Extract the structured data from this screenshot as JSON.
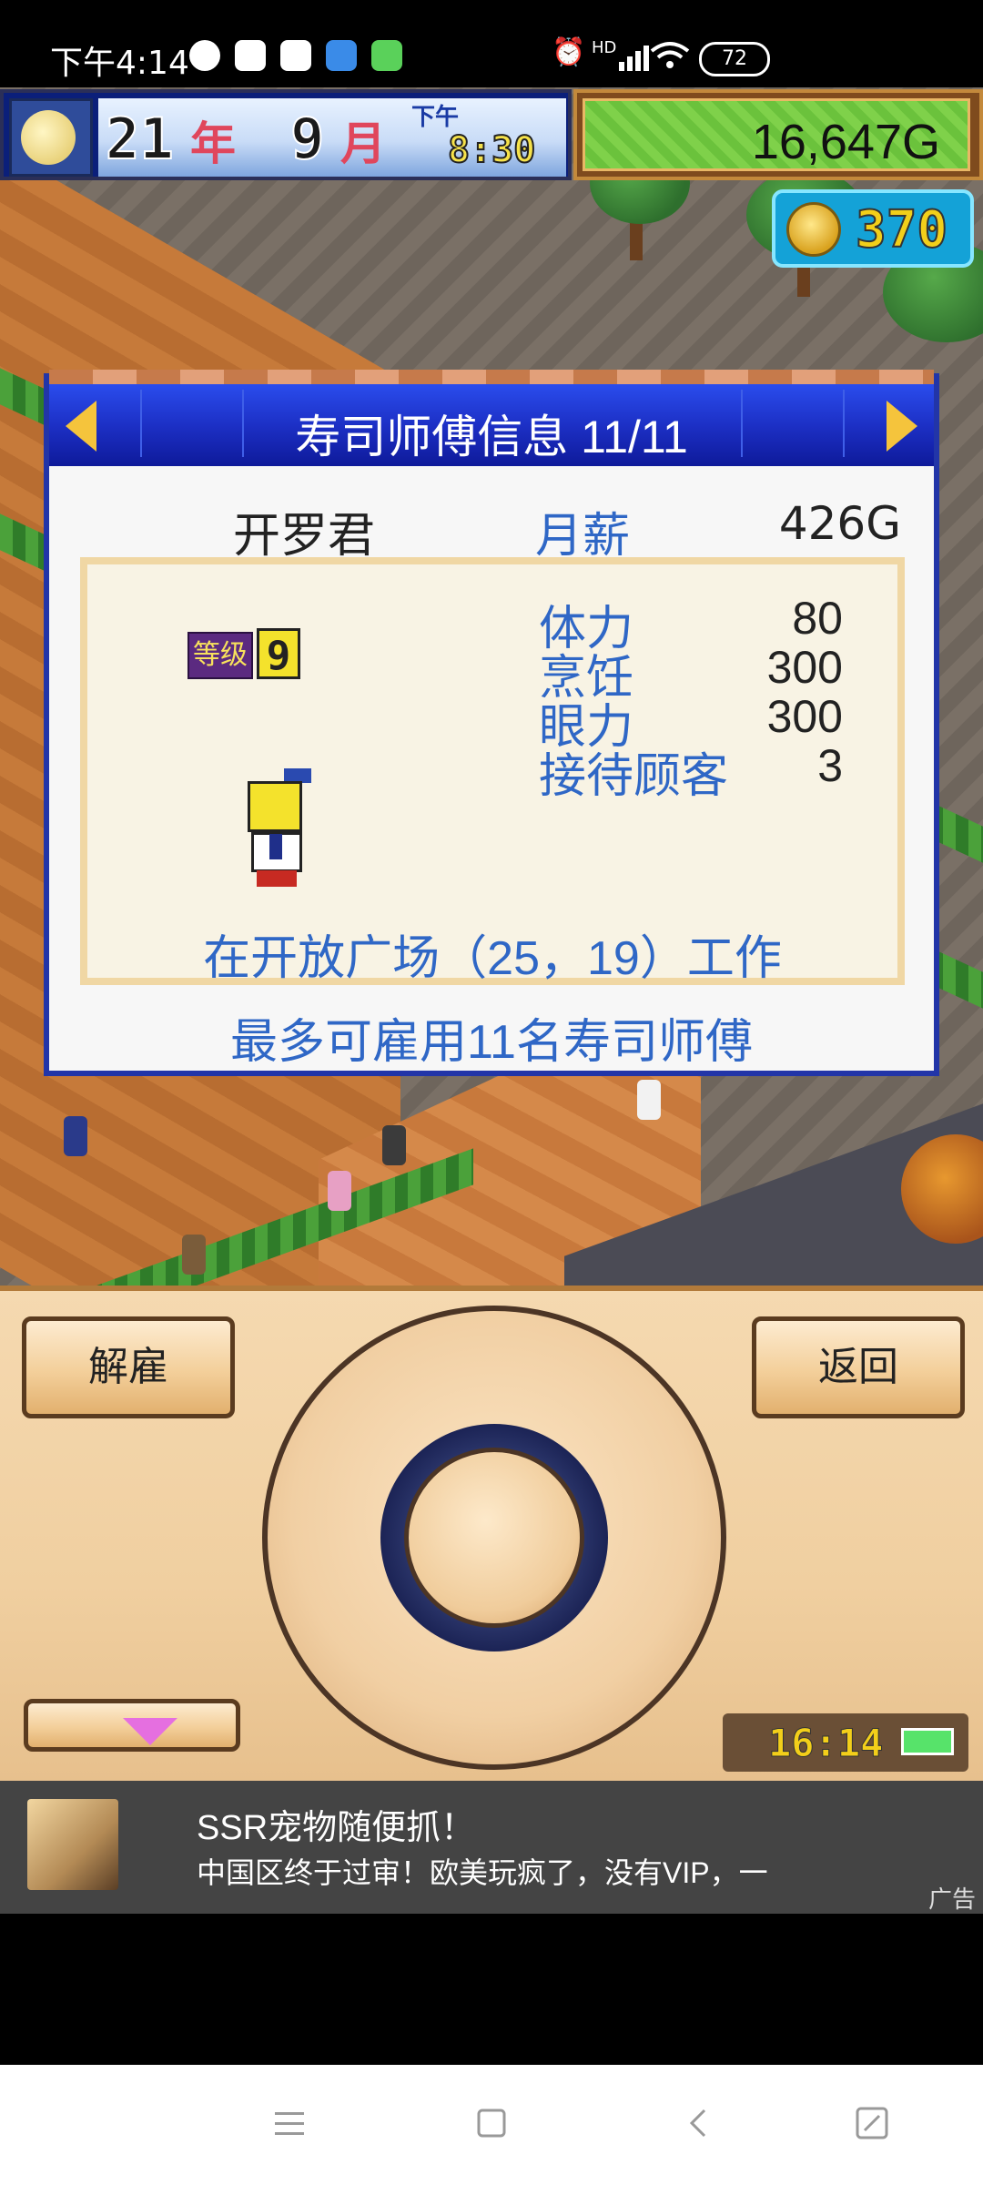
{
  "status_bar": {
    "time": "下午4:14",
    "network": "HD",
    "battery_level": "72"
  },
  "hud": {
    "year_num": "21",
    "year_unit": "年",
    "month_num": "9",
    "month_unit": "月",
    "ampm": "下午",
    "clock": "8:30",
    "money": "16,647G",
    "coins": "370"
  },
  "dialog": {
    "title": "寿司师傅信息 11/11",
    "name": "开罗君",
    "salary_label": "月薪",
    "salary_value": "426G",
    "level_badge": "等级",
    "level_value": "9",
    "stats": [
      {
        "label": "体力",
        "value": "80"
      },
      {
        "label": "烹饪",
        "value": "300"
      },
      {
        "label": "眼力",
        "value": "300"
      },
      {
        "label": "接待顾客",
        "value": "3"
      }
    ],
    "work_location": "在开放广场（25，19）工作",
    "hire_limit": "最多可雇用11名寿司师傅"
  },
  "controls": {
    "fire_label": "解雇",
    "back_label": "返回",
    "device_time": "16:14"
  },
  "ad": {
    "title": "SSR宠物随便抓！",
    "description": "中国区终于过审！欧美玩疯了，没有VIP，一",
    "tag": "广告"
  },
  "colors": {
    "dialog_header": "#1c2fc4",
    "accent_blue_text": "#2f67c6",
    "money_bg": "#6bc23c",
    "coin_box": "#14a2d7"
  }
}
